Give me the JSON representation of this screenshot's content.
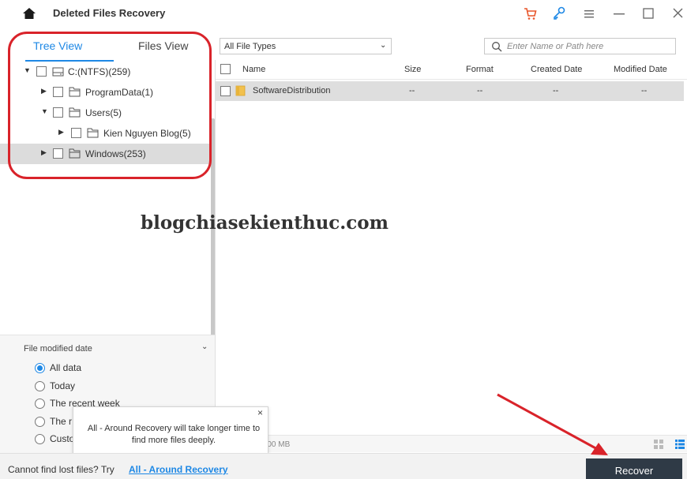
{
  "app": {
    "title": "Deleted Files Recovery"
  },
  "titlebar_icons": [
    "home-icon",
    "cart-icon",
    "key-icon",
    "menu-icon",
    "minimize-icon",
    "maximize-icon",
    "close-icon"
  ],
  "tabs": [
    {
      "label": "Tree View",
      "active": true
    },
    {
      "label": "Files View",
      "active": false
    }
  ],
  "tree": [
    {
      "label": "C:(NTFS)(259)",
      "expanded": true,
      "level": 0,
      "icon": "drive-icon"
    },
    {
      "label": "ProgramData(1)",
      "expanded": false,
      "level": 1,
      "icon": "folder-outline-icon"
    },
    {
      "label": "Users(5)",
      "expanded": true,
      "level": 1,
      "icon": "folder-outline-icon"
    },
    {
      "label": "Kien Nguyen Blog(5)",
      "expanded": false,
      "level": 2,
      "icon": "folder-outline-icon"
    },
    {
      "label": "Windows(253)",
      "expanded": false,
      "level": 1,
      "icon": "folder-outline-icon",
      "selected": true
    }
  ],
  "filter": {
    "title": "File modified date",
    "options": [
      "All data",
      "Today",
      "The recent week",
      "The r",
      "Custo"
    ],
    "selected": "All data"
  },
  "tooltip": {
    "text": "All - Around Recovery will take longer time to find more files deeply.",
    "close": "×"
  },
  "toolbar": {
    "file_type": "All File Types",
    "search_placeholder": "Enter Name or Path here"
  },
  "table": {
    "columns": [
      "Name",
      "Size",
      "Format",
      "Created Date",
      "Modified Date"
    ],
    "rows": [
      {
        "name": "SoftwareDistribution",
        "size": "--",
        "format": "--",
        "created": "--",
        "modified": "--"
      }
    ]
  },
  "status": {
    "size": "1.00 MB"
  },
  "bottom": {
    "prompt": "Cannot find lost files? Try",
    "link": "All - Around Recovery",
    "recover_label": "Recover"
  },
  "watermark": "blogchiasekienthuc.com",
  "colors": {
    "accent": "#1e88e5",
    "annotation_red": "#d9232a",
    "button_dark": "#2f3a46",
    "cart_orange": "#e8552a"
  }
}
